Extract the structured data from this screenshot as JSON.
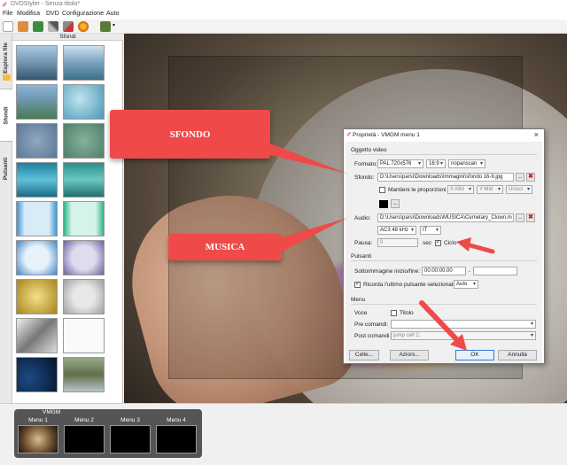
{
  "app": {
    "title": "DVDStyler - Senza titolo*"
  },
  "menubar": {
    "items": [
      "File",
      "Modifica",
      "DVD",
      "Configurazione",
      "Auto"
    ]
  },
  "sidetabs": {
    "explorer": "Esplora file",
    "backgrounds": "Sfondi",
    "buttons": "Pulsanti"
  },
  "panel": {
    "header": "Sfondi"
  },
  "callouts": {
    "background": "SFONDO",
    "music": "MUSICA"
  },
  "filmstrip": {
    "group_label": "VMGM",
    "menus": [
      "Menu 1",
      "Menu 2",
      "Menu 3",
      "Menu 4"
    ]
  },
  "dialog": {
    "title": "Proprietà - VMGM menu 1",
    "video_group": "Oggetto video",
    "format_label": "Formato:",
    "format_value": "PAL 720x576",
    "aspect_value": "16:9",
    "panscan_value": "nopanscan",
    "background_label": "Sfondo:",
    "background_path": "D:\\Users\\parsi\\Downloads\\Immagini\\sfondo 16-9.jpg",
    "keep_ratio_label": "Mantieni le proporzioni",
    "xmid": "X-Mid",
    "ymid": "Y-Mid",
    "union": "Unisci",
    "audio_label": "Audio:",
    "audio_path": "D:\\Users\\parsi\\Downloads\\MUSICA\\Cemetary_Clown.m",
    "audio_codec": "AC3 48 kHz",
    "audio_lang": "IT",
    "pause_label": "Pausa:",
    "pause_value": "0",
    "sec_label": "sec",
    "loop_label": "Ciclo",
    "buttons_group": "Pulsanti",
    "subpic_label": "Sottoimmagine inizio/fine:",
    "subpic_start": "00:00:00.00",
    "subpic_dash": "-",
    "remember_label": "Ricorda l'ultimo pulsante selezionato",
    "remember_value": "Auto",
    "menu_group": "Menu",
    "voice_label": "Voce",
    "title_label": "Titolo",
    "pre_label": "Pre comandi:",
    "post_label": "Post comandi:",
    "post_value": "jump cell 1;",
    "cells_btn": "Celle...",
    "actions_btn": "Azioni...",
    "ok_btn": "OK",
    "cancel_btn": "Annulla",
    "ellipsis": "..."
  },
  "colors": {
    "callout": "#ef4a49",
    "accent": "#3377dd"
  }
}
